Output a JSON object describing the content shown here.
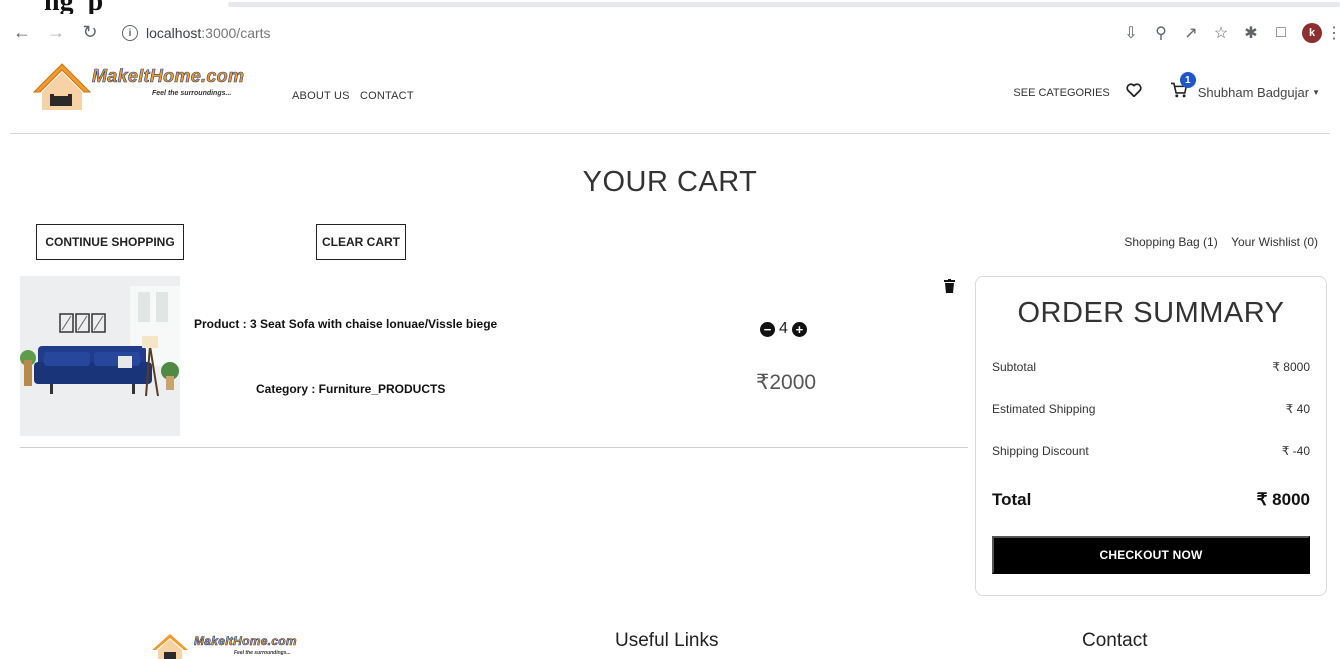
{
  "browser": {
    "url_host": "localhost",
    "url_path": ":3000/carts"
  },
  "header": {
    "logo_text": "MakeItHome.com",
    "logo_tagline": "Feel the surroundings...",
    "nav": [
      "ABOUT US",
      "CONTACT"
    ],
    "see_categories": "SEE CATEGORIES",
    "cart_count": "1",
    "user_name": "Shubham Badgujar"
  },
  "page": {
    "title": "YOUR CART",
    "continue_shopping": "CONTINUE SHOPPING",
    "clear_cart": "CLEAR CART",
    "shopping_bag": "Shopping Bag (1)",
    "wishlist": "Your Wishlist (0)"
  },
  "cart_item": {
    "product": "Product : 3 Seat Sofa with chaise lonuae/Vissle biege",
    "category": "Category : Furniture_PRODUCTS",
    "quantity": "4",
    "price": "₹2000"
  },
  "summary": {
    "title": "ORDER SUMMARY",
    "subtotal_label": "Subtotal",
    "subtotal_value": "₹ 8000",
    "shipping_label": "Estimated Shipping",
    "shipping_value": "₹ 40",
    "discount_label": "Shipping Discount",
    "discount_value": "₹ -40",
    "total_label": "Total",
    "total_value": "₹ 8000",
    "checkout": "CHECKOUT NOW"
  },
  "footer": {
    "useful_links": "Useful Links",
    "contact": "Contact"
  },
  "colors": {
    "brand_orange": "#f39a2b",
    "brand_blue": "#1c3f87",
    "cart_badge": "#1f56c8",
    "checkout_bg": "#000000"
  }
}
